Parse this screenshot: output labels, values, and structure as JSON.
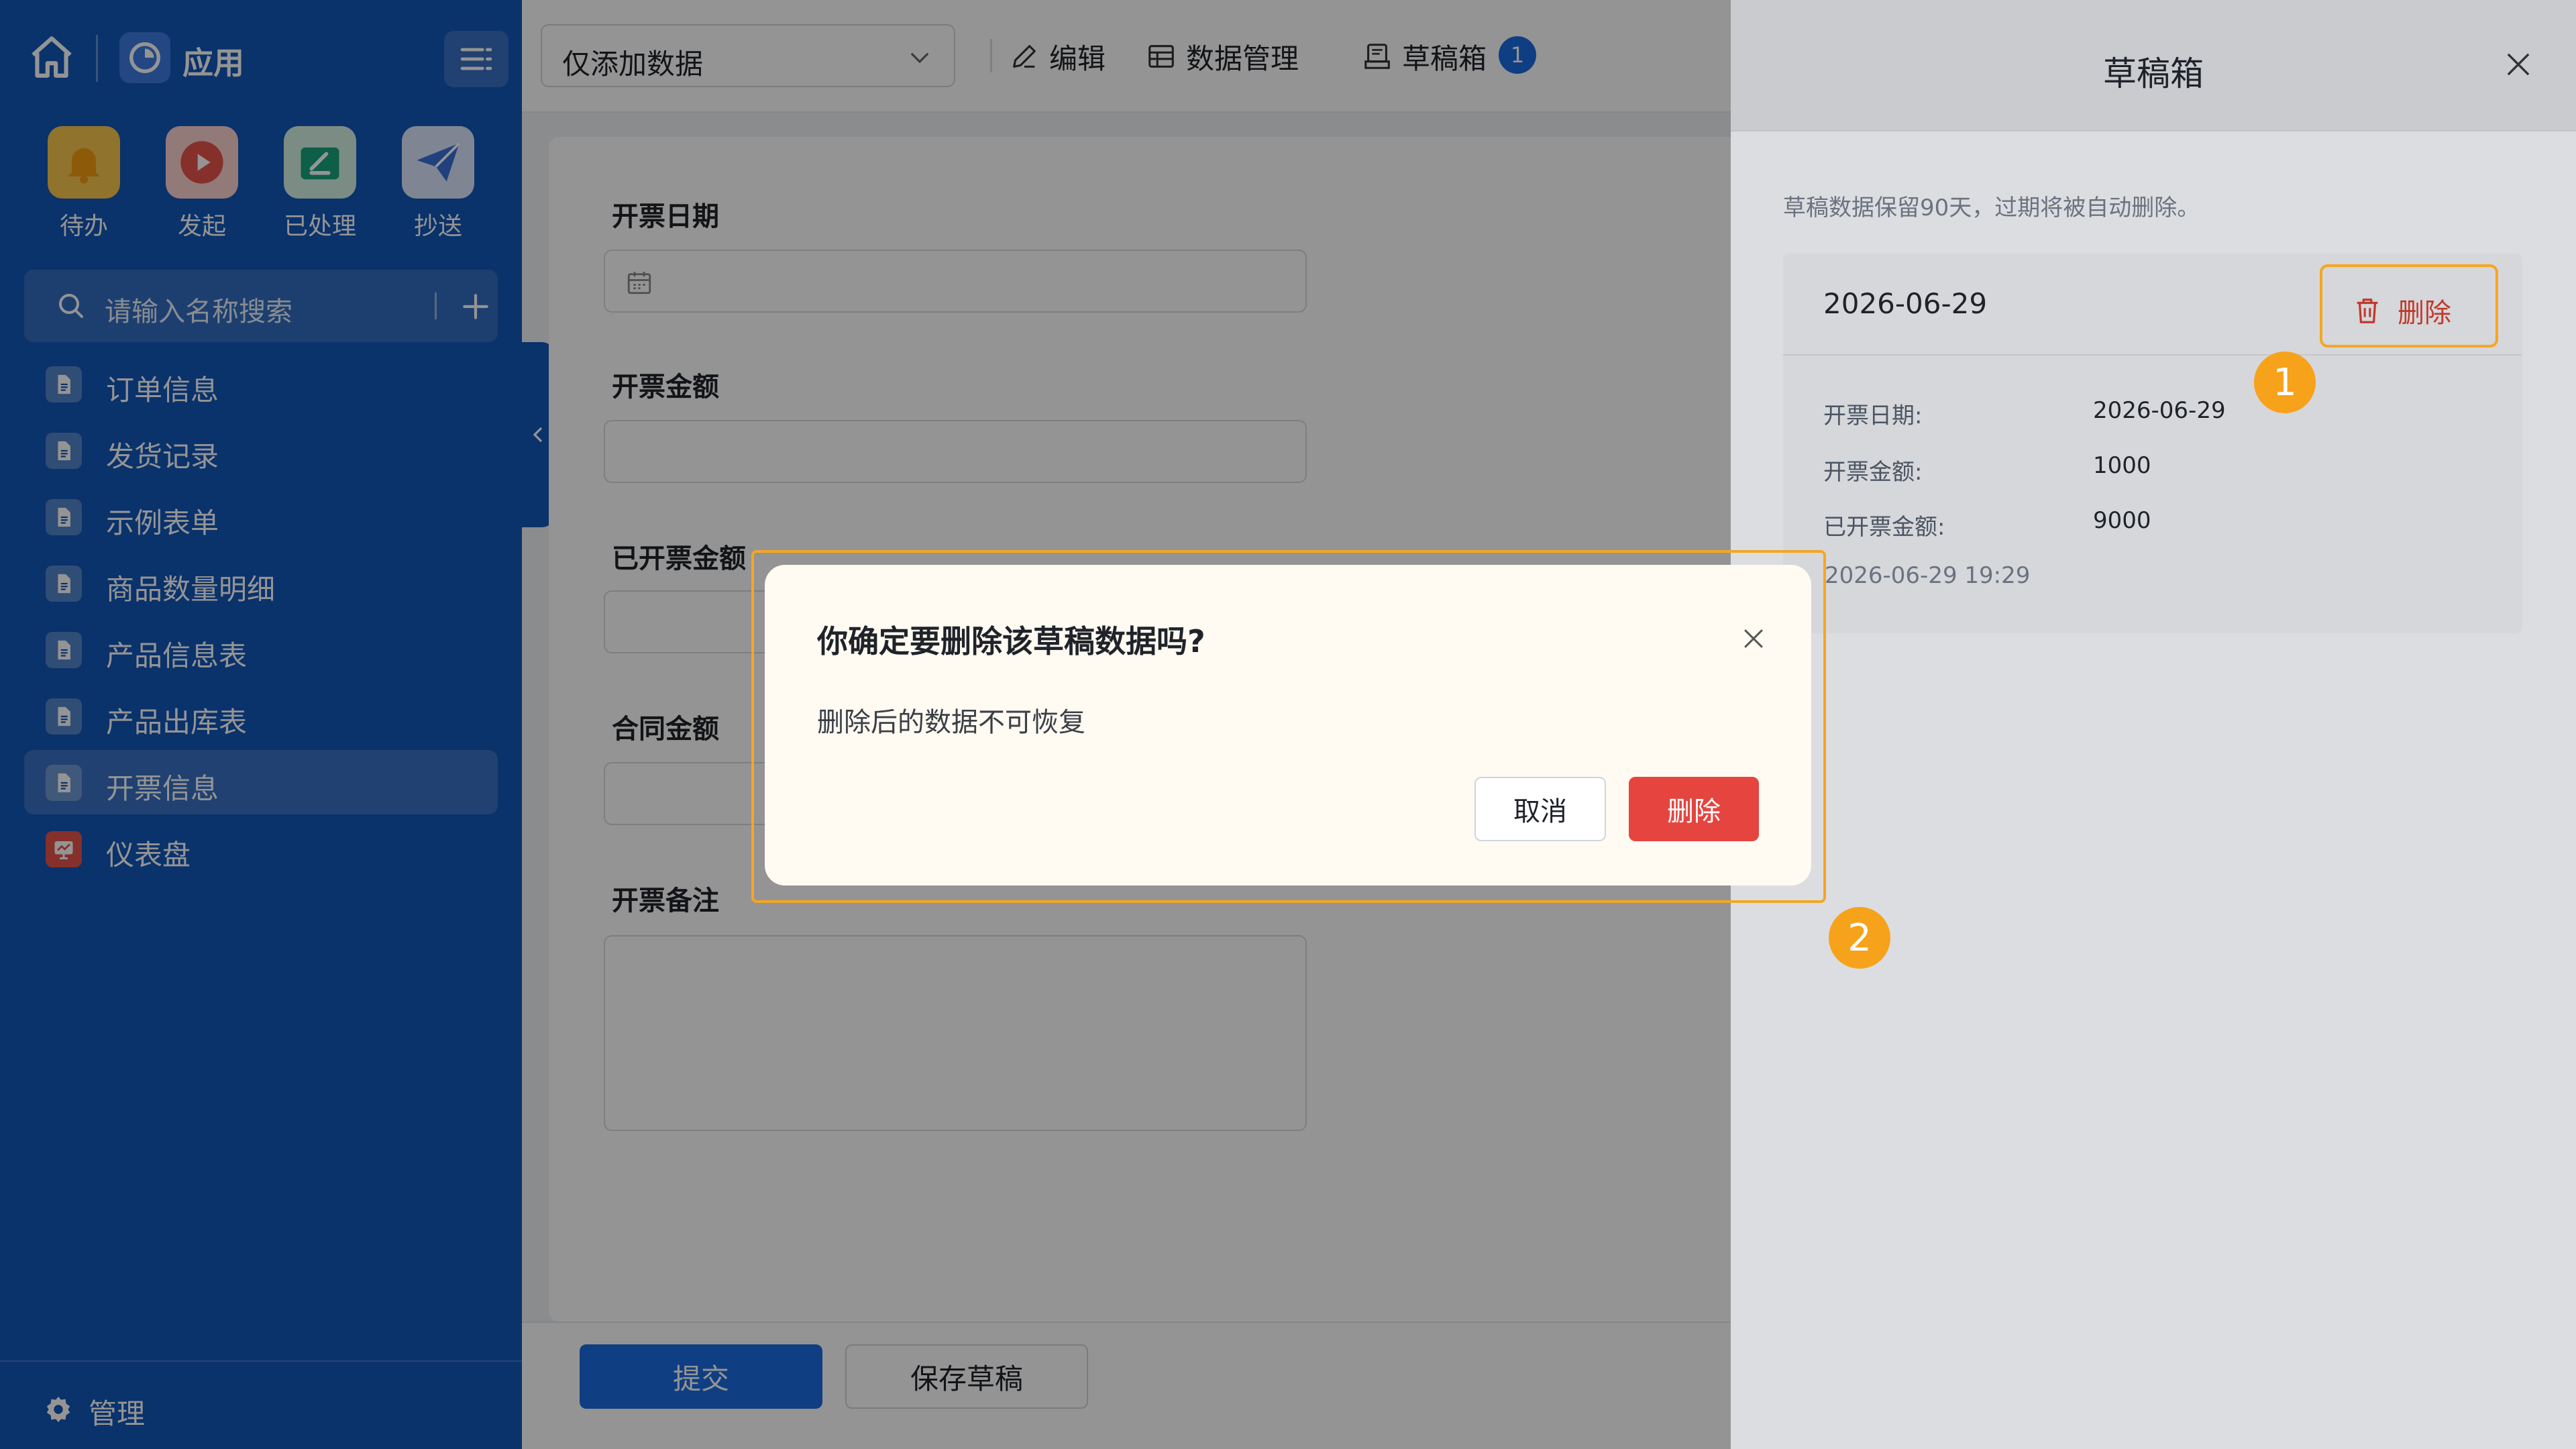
{
  "sidebar": {
    "app_title": "应用",
    "quick_actions": [
      {
        "label": "待办",
        "icon": "bell-icon"
      },
      {
        "label": "发起",
        "icon": "play-icon"
      },
      {
        "label": "已处理",
        "icon": "processed-icon"
      },
      {
        "label": "抄送",
        "icon": "send-icon"
      }
    ],
    "search": {
      "placeholder": "请输入名称搜索"
    },
    "nav_items": [
      {
        "label": "订单信息"
      },
      {
        "label": "发货记录"
      },
      {
        "label": "示例表单"
      },
      {
        "label": "商品数量明细"
      },
      {
        "label": "产品信息表"
      },
      {
        "label": "产品出库表"
      },
      {
        "label": "开票信息",
        "active": true
      },
      {
        "label": "仪表盘"
      }
    ],
    "manage_label": "管理",
    "color": "#1256b8"
  },
  "toolbar": {
    "filter_value": "仅添加数据",
    "edit_label": "编辑",
    "data_manage_label": "数据管理",
    "drafts_label": "草稿箱",
    "drafts_count": "1"
  },
  "form": {
    "fields": [
      {
        "label": "开票日期"
      },
      {
        "label": "开票金额"
      },
      {
        "label": "已开票金额"
      },
      {
        "label": "合同金额"
      },
      {
        "label": "开票备注"
      }
    ],
    "submit_label": "提交",
    "save_draft_label": "保存草稿"
  },
  "drawer": {
    "title": "草稿箱",
    "note": "草稿数据保留90天，过期将被自动删除。",
    "draft": {
      "date": "2026-06-29",
      "delete_label": "删除",
      "rows": [
        {
          "label": "开票日期:",
          "value": "2026-06-29"
        },
        {
          "label": "开票金额:",
          "value": "1000"
        },
        {
          "label": "已开票金额:",
          "value": "9000"
        }
      ],
      "timestamp": "2026-06-29 19:29"
    }
  },
  "modal": {
    "title": "你确定要删除该草稿数据吗?",
    "body": "删除后的数据不可恢复",
    "cancel_label": "取消",
    "delete_label": "删除"
  },
  "steps": [
    "1",
    "2"
  ],
  "colors": {
    "primary": "#1a6be0",
    "danger": "#e5443f",
    "highlight": "#f5a623"
  }
}
